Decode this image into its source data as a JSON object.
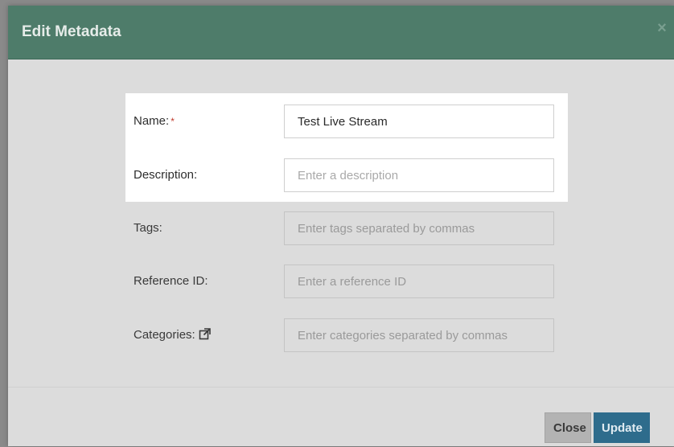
{
  "modal": {
    "title": "Edit Metadata",
    "close_icon": "×"
  },
  "form": {
    "name": {
      "label": "Name:",
      "required_marker": "*",
      "value": "Test Live Stream",
      "placeholder": ""
    },
    "description": {
      "label": "Description:",
      "value": "",
      "placeholder": "Enter a description"
    },
    "tags": {
      "label": "Tags:",
      "value": "",
      "placeholder": "Enter tags separated by commas"
    },
    "reference_id": {
      "label": "Reference ID:",
      "value": "",
      "placeholder": "Enter a reference ID"
    },
    "categories": {
      "label": "Categories:",
      "icon": "external-link-icon",
      "value": "",
      "placeholder": "Enter categories separated by commas"
    }
  },
  "footer": {
    "close_label": "Close",
    "update_label": "Update"
  },
  "colors": {
    "header": "#4e7c6a",
    "update_button": "#2e6c8c",
    "close_button": "#b3b3b3",
    "required": "#c0392b"
  }
}
